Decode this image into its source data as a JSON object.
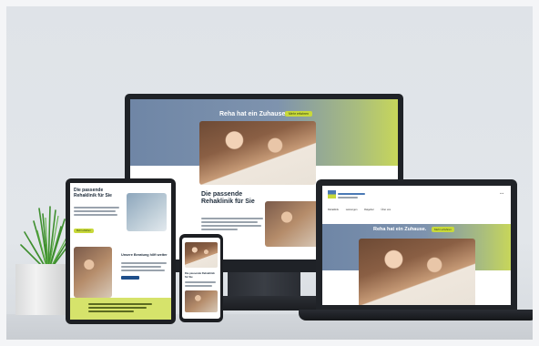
{
  "monitor": {
    "hero_title": "Reha hat ein Zuhause.",
    "badge": "Mehr erfahren",
    "heading": "Die passende Rehaklinik für Sie"
  },
  "laptop": {
    "hero_title": "Reha hat ein Zuhause.",
    "badge": "Mehr erfahren",
    "nav": [
      "Rehaklinik",
      "Leistungen",
      "Ratgeber",
      "Über uns"
    ]
  },
  "tablet": {
    "heading": "Die passende Rehaklinik für Sie",
    "badge": "Mehr erfahren",
    "subheading": "Unsere Beratung hilft weiter"
  },
  "phone": {
    "heading": "Die passende Rehaklinik für Sie"
  },
  "colors": {
    "accent": "#c8d93a",
    "hero_blue": "#6f86a6",
    "button": "#1f4f8b"
  }
}
